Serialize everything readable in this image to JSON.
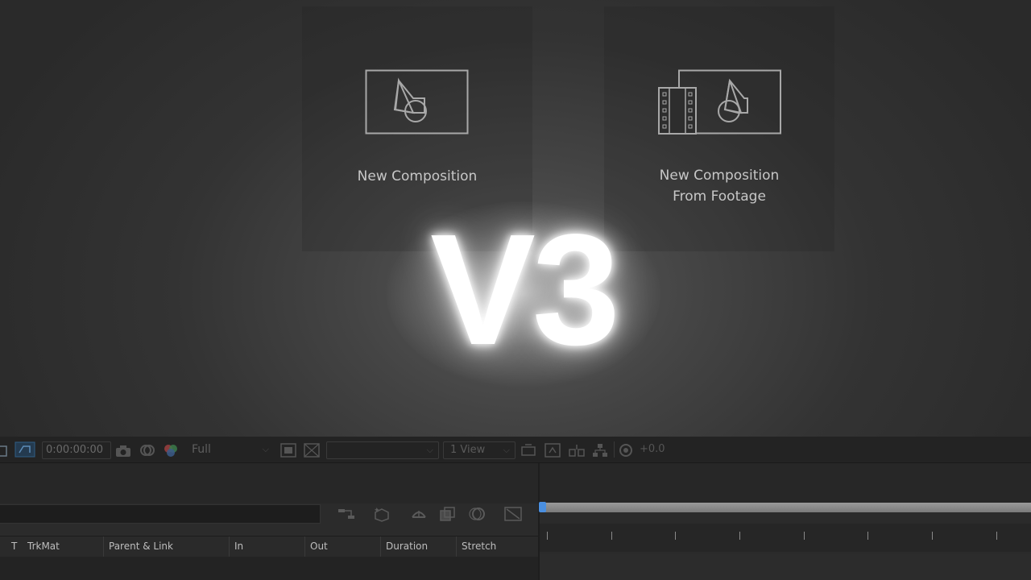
{
  "start_panels": {
    "new_composition": {
      "label": "New Composition"
    },
    "new_composition_from_footage": {
      "label_line1": "New Composition",
      "label_line2": "From Footage"
    }
  },
  "overlay": {
    "title": "V3"
  },
  "viewer_toolbar": {
    "timecode": "0:00:00:00",
    "resolution": "Full",
    "view_layout": "1 View",
    "exposure": "+0.0"
  },
  "timeline": {
    "columns": [
      "T",
      "TrkMat",
      "Parent & Link",
      "In",
      "Out",
      "Duration",
      "Stretch"
    ]
  },
  "colors": {
    "playhead": "#4a8fe0",
    "title_glow": "#ffffff",
    "panel_text": "#c7c7c7"
  }
}
